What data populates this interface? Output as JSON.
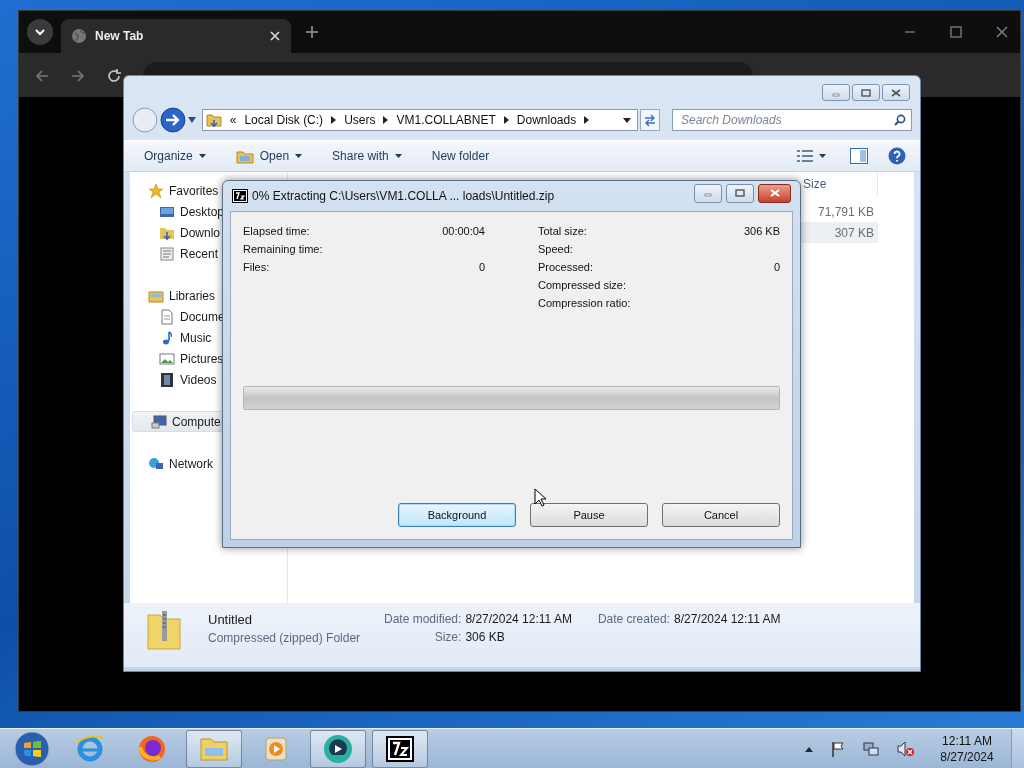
{
  "browser": {
    "tabs": [
      {
        "title": "New Tab",
        "selected": true
      }
    ]
  },
  "explorer": {
    "breadcrumb": [
      "«",
      "Local Disk (C:)",
      "Users",
      "VM1.COLLABNET",
      "Downloads"
    ],
    "search": {
      "placeholder": "Search Downloads"
    },
    "toolbar": [
      {
        "label": "Organize",
        "dropdown": true,
        "kind": "plain"
      },
      {
        "label": "Open",
        "dropdown": true,
        "kind": "open"
      },
      {
        "label": "Share with",
        "dropdown": true,
        "kind": "plain"
      },
      {
        "label": "New folder",
        "dropdown": false,
        "kind": "plain"
      }
    ],
    "sidebar": [
      {
        "label": "Favorites",
        "kind": "star",
        "selected": false,
        "children": [
          {
            "label": "Desktop",
            "kind": "desktop",
            "selected": false
          },
          {
            "label": "Downlo",
            "kind": "downloads",
            "selected": false
          },
          {
            "label": "Recent",
            "kind": "recent",
            "selected": false
          }
        ]
      },
      {
        "label": "Libraries",
        "kind": "libraries",
        "selected": false,
        "children": [
          {
            "label": "Docume",
            "kind": "documents",
            "selected": false
          },
          {
            "label": "Music",
            "kind": "music",
            "selected": false
          },
          {
            "label": "Pictures",
            "kind": "pictures",
            "selected": false
          },
          {
            "label": "Videos",
            "kind": "videos",
            "selected": false
          }
        ]
      },
      {
        "label": "Compute",
        "kind": "computer",
        "selected": true
      },
      {
        "label": "Network",
        "kind": "network",
        "selected": false
      }
    ],
    "columns": [
      "Size"
    ],
    "rows": [
      {
        "size": "71,791 KB",
        "selected": false
      },
      {
        "size": "307 KB",
        "selected": true
      }
    ],
    "details": {
      "name": "Untitled",
      "type": "Compressed (zipped) Folder",
      "fields": [
        {
          "label": "Date modified:",
          "value": "8/27/2024 12:11 AM"
        },
        {
          "label": "Size:",
          "value": "306 KB"
        },
        {
          "label": "Date created:",
          "value": "8/27/2024 12:11 AM"
        }
      ]
    }
  },
  "dialog": {
    "title": "0% Extracting C:\\Users\\VM1.COLLA ... loads\\Untitled.zip",
    "left_stats": [
      {
        "label": "Elapsed time:",
        "value": "00:00:04"
      },
      {
        "label": "Remaining time:"
      },
      {
        "label": "Files:",
        "value": "0"
      }
    ],
    "right_stats": [
      {
        "label": "Total size:",
        "value": "306 KB"
      },
      {
        "label": "Speed:"
      },
      {
        "label": "Processed:",
        "value": "0"
      },
      {
        "label": "Compressed size:"
      },
      {
        "label": "Compression ratio:"
      }
    ],
    "progress": {
      "level": 0
    },
    "buttons": [
      {
        "label": "Background",
        "focused": true
      },
      {
        "label": "Pause",
        "focused": false
      },
      {
        "label": "Cancel",
        "focused": false
      }
    ]
  },
  "taskbar": {
    "apps": [
      {
        "kind": "ie",
        "active": false
      },
      {
        "kind": "firefox",
        "active": false
      },
      {
        "kind": "folder",
        "active": true
      },
      {
        "kind": "media",
        "active": false
      },
      {
        "kind": "orb",
        "active": true
      },
      {
        "kind": "sevenzip",
        "active": true
      }
    ],
    "time": "12:11 AM",
    "date": "8/27/2024"
  }
}
